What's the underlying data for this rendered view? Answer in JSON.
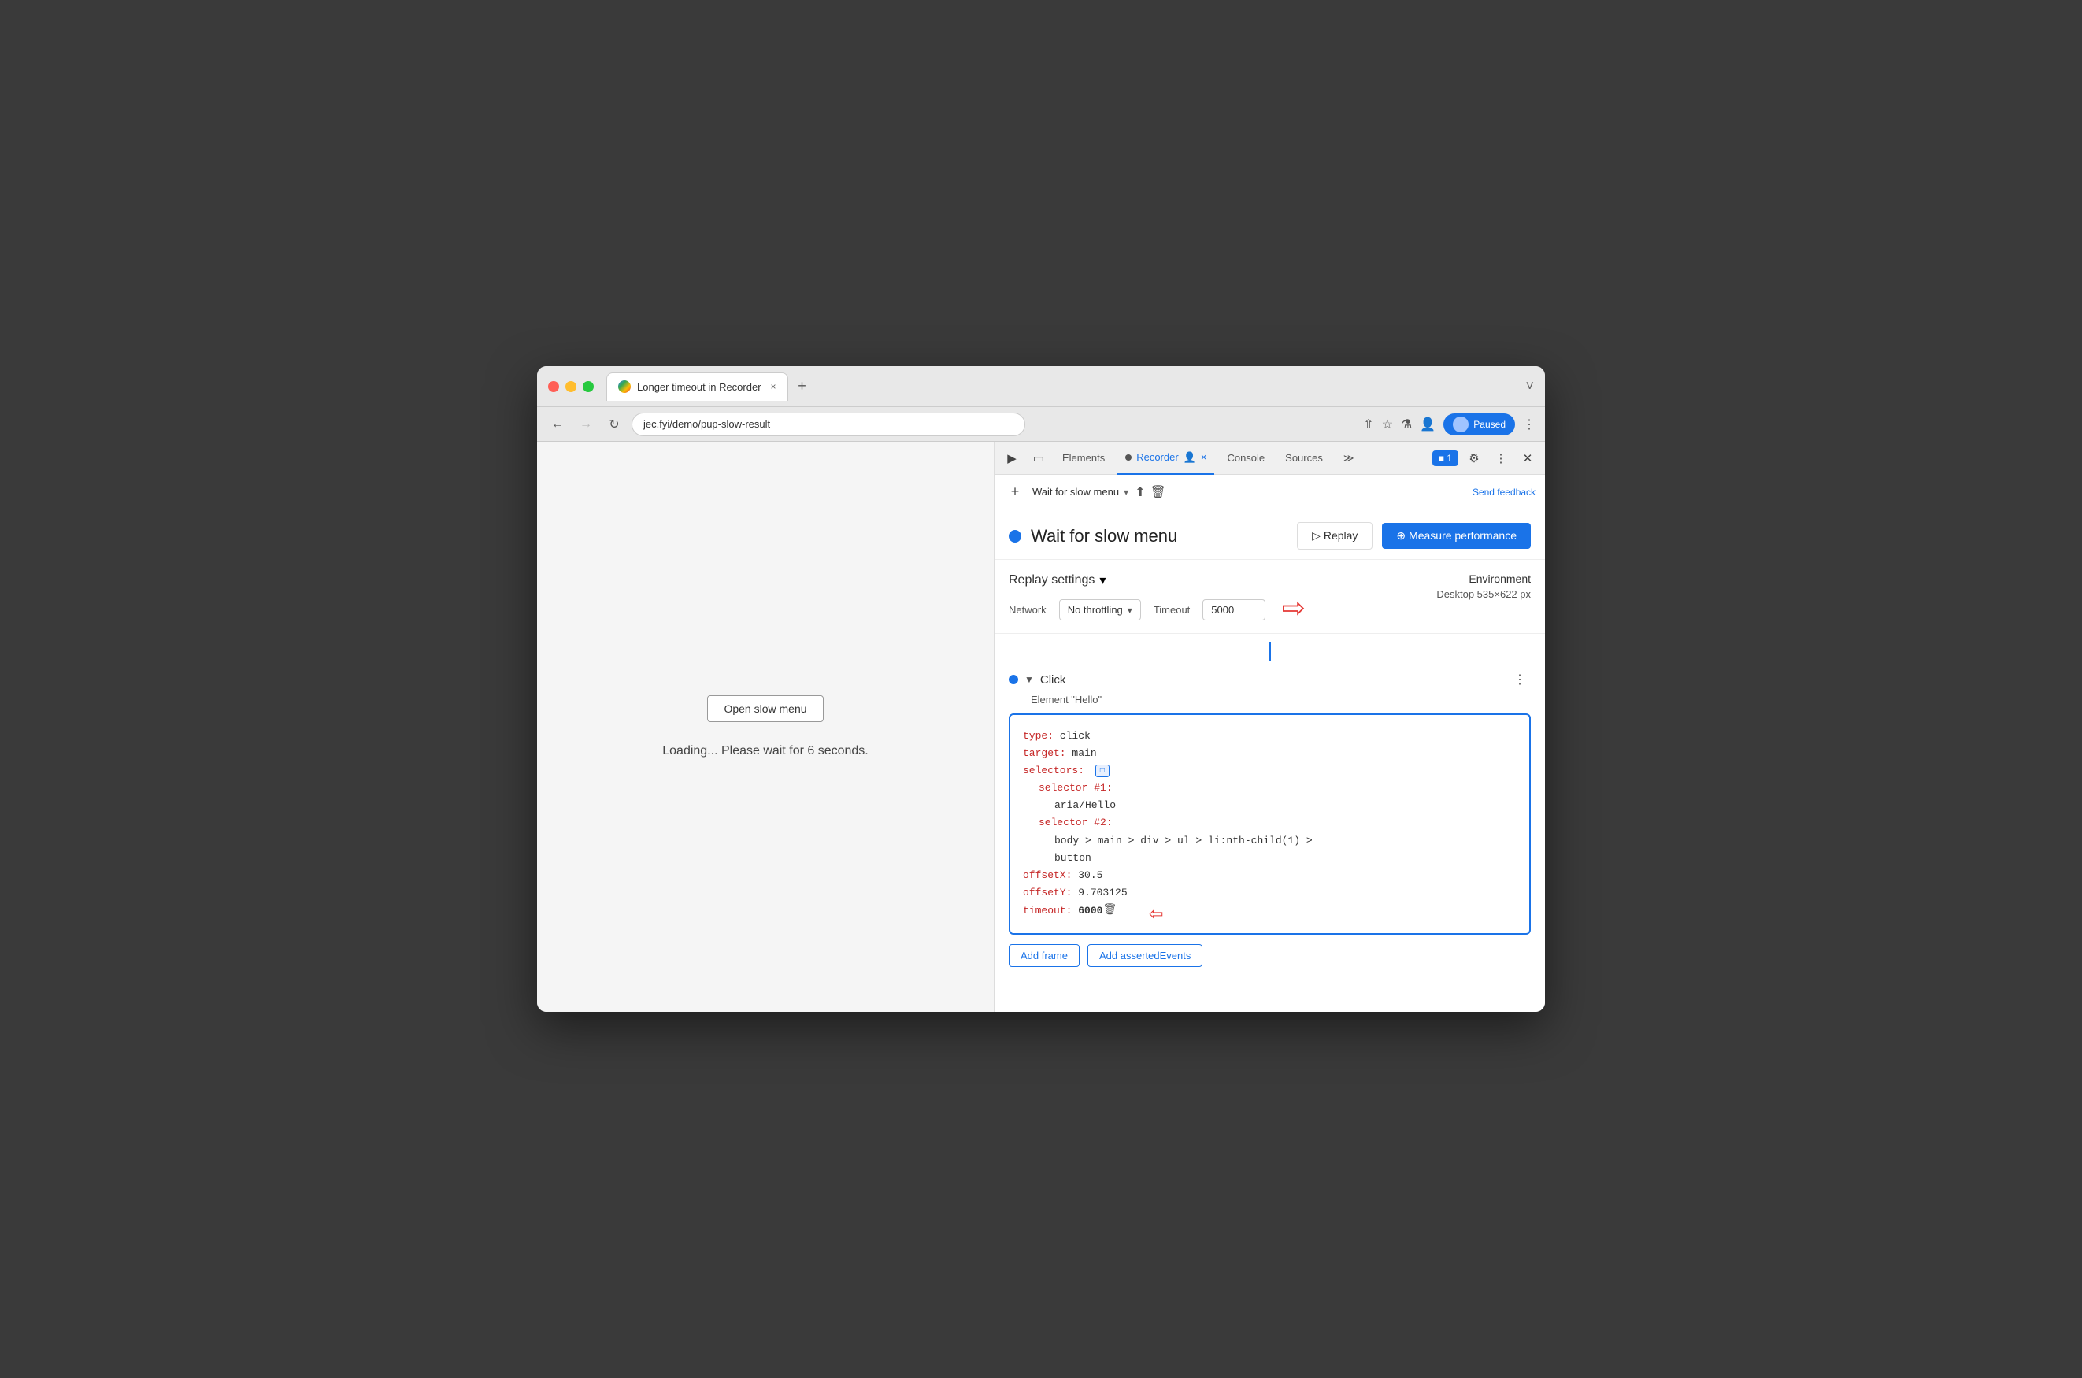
{
  "window": {
    "title": "Longer timeout in Recorder",
    "url": "jec.fyi/demo/pup-slow-result",
    "tab_close": "×",
    "tab_new": "+",
    "window_controls": "˅"
  },
  "nav": {
    "back_disabled": false,
    "forward_disabled": true,
    "paused_label": "Paused"
  },
  "devtools": {
    "tabs": [
      "Elements",
      "Recorder",
      "Console",
      "Sources"
    ],
    "recorder_tab_label": "Recorder",
    "close_label": "×",
    "more_label": "≫",
    "chat_badge": "■ 1",
    "send_feedback": "Send feedback"
  },
  "recorder": {
    "add_btn": "+",
    "recording_name": "Wait for slow menu",
    "chevron": "▾",
    "export_icon": "⬆",
    "delete_icon": "🗑",
    "title": "Wait for slow menu",
    "replay_btn": "▷ Replay",
    "measure_btn": "⊕ Measure performance"
  },
  "replay_settings": {
    "title": "Replay settings",
    "chevron": "▾",
    "network_label": "Network",
    "network_value": "No throttling",
    "network_chevron": "▾",
    "timeout_label": "Timeout",
    "timeout_value": "5000",
    "env_title": "Environment",
    "env_value": "Desktop  535×622 px"
  },
  "click_step": {
    "step_type": "Click",
    "step_element": "Element \"Hello\"",
    "more_icon": "⋮",
    "code": {
      "type_key": "type:",
      "type_val": " click",
      "target_key": "target:",
      "target_val": " main",
      "selectors_key": "selectors:",
      "selector1_key": "selector #1:",
      "selector1_val": "aria/Hello",
      "selector2_key": "selector #2:",
      "selector2_val": "body > main > div > ul > li:nth-child(1) >",
      "selector2_val2": "button",
      "offsetX_key": "offsetX:",
      "offsetX_val": " 30.5",
      "offsetY_key": "offsetY:",
      "offsetY_val": " 9.703125",
      "timeout_key": "timeout:",
      "timeout_val": " 6000",
      "selector_icon": "⊡"
    },
    "add_frame_btn": "Add frame",
    "add_asserted_btn": "Add assertedEvents"
  },
  "browser_page": {
    "open_btn": "Open slow menu",
    "loading_text": "Loading... Please wait for 6 seconds."
  }
}
